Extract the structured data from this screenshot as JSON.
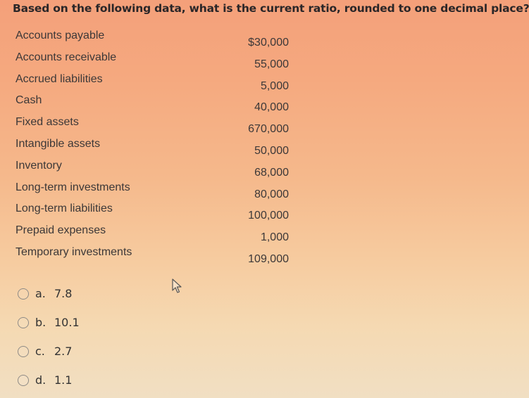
{
  "question": "Based on the following data, what is the current ratio, rounded to one decimal place?",
  "items": [
    {
      "label": "Accounts payable",
      "value": "$30,000"
    },
    {
      "label": "Accounts receivable",
      "value": "55,000"
    },
    {
      "label": "Accrued liabilities",
      "value": "5,000"
    },
    {
      "label": "Cash",
      "value": "40,000"
    },
    {
      "label": "Fixed assets",
      "value": "670,000"
    },
    {
      "label": "Intangible assets",
      "value": "50,000"
    },
    {
      "label": "Inventory",
      "value": "68,000"
    },
    {
      "label": "Long-term investments",
      "value": "80,000"
    },
    {
      "label": "Long-term liabilities",
      "value": "100,000"
    },
    {
      "label": "Prepaid expenses",
      "value": "1,000"
    },
    {
      "label": "Temporary investments",
      "value": "109,000"
    }
  ],
  "options": [
    {
      "letter": "a.",
      "text": "7.8",
      "selected": false
    },
    {
      "letter": "b.",
      "text": "10.1",
      "selected": false
    },
    {
      "letter": "c.",
      "text": "2.7",
      "selected": false
    },
    {
      "letter": "d.",
      "text": "1.1",
      "selected": false
    }
  ],
  "icons": {
    "cursor": "mouse-pointer-icon",
    "radio": "radio-unselected-icon"
  }
}
